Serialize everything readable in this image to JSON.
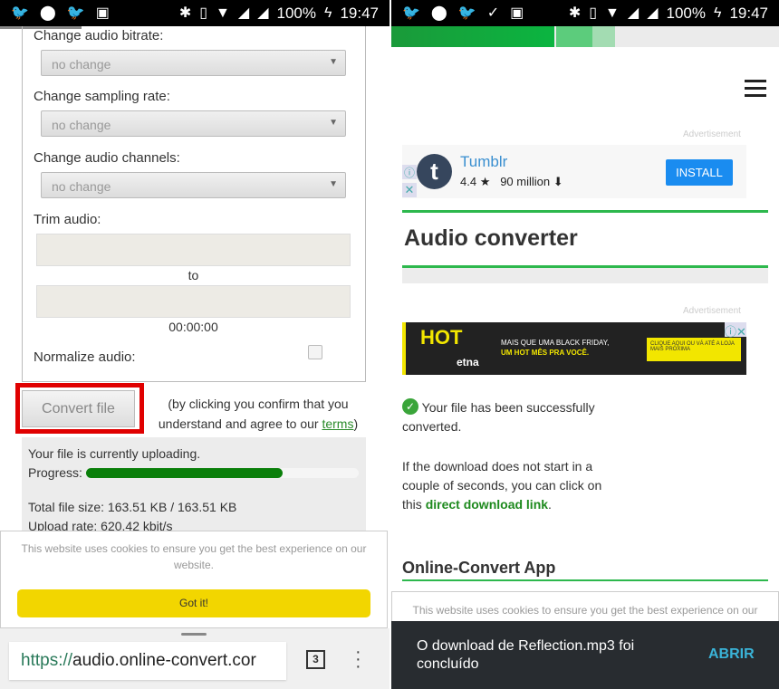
{
  "status_bar": {
    "left_icons": [
      "twitter-icon",
      "periscope-icon",
      "twitter-icon",
      "image-icon"
    ],
    "right_left_icons": [
      "twitter-icon",
      "periscope-icon",
      "twitter-icon",
      "download-done-icon",
      "image-icon"
    ],
    "system_icons": [
      "bluetooth-icon",
      "vibrate-icon",
      "wifi-icon",
      "signal-icon",
      "signal-icon"
    ],
    "battery": "100%",
    "time": "19:47"
  },
  "left": {
    "options": [
      {
        "label": "Change audio bitrate:",
        "value": "no change"
      },
      {
        "label": "Change sampling rate:",
        "value": "no change"
      },
      {
        "label": "Change audio channels:",
        "value": "no change"
      }
    ],
    "trim_label": "Trim audio:",
    "trim_to": "to",
    "trim_time": "00:00:00",
    "normalize_label": "Normalize audio:",
    "normalize_checked": false,
    "convert_button": "Convert file",
    "terms_text_1": "(by clicking you confirm that you",
    "terms_text_2": "understand and agree to our ",
    "terms_link": "terms",
    "terms_close": ")",
    "upload_status": "Your file is currently uploading.",
    "progress_label": "Progress:",
    "progress_percent": 72,
    "total_size": "Total file size: 163.51 KB / 163.51 KB",
    "upload_rate": "Upload rate: 620.42 kbit/s",
    "cookie_text": "This website uses cookies to ensure you get the best experience on our website.",
    "cookie_button": "Got it!",
    "url_scheme": "https://",
    "url_host": "audio.online-convert.cor",
    "tab_count": "3",
    "highlight_color": "#e00000"
  },
  "right": {
    "page_load_percent": 42,
    "ad_label": "Advertisement",
    "ad1": {
      "app": "Tumblr",
      "rating": "4.4",
      "downloads": "90 million",
      "button": "INSTALL"
    },
    "title": "Audio converter",
    "ad2_label": "Advertisement",
    "ad2": {
      "brand": "HOT",
      "sub": "etna",
      "line1": "MAIS QUE UMA BLACK FRIDAY,",
      "line2": "UM HOT MÊS PRA VOCÊ.",
      "cta": "CLIQUE AQUI OU VÁ ATÉ A LOJA MAIS PRÓXIMA"
    },
    "success_text": "Your file has been successfully converted.",
    "download_text": "If the download does not start in a couple of seconds, you can click on this ",
    "download_link": "direct download link",
    "download_end": ".",
    "app_heading": "Online-Convert App",
    "cookie_text": "This website uses cookies to ensure you get the best experience on our",
    "snackbar_text": "O download de Reflection.mp3 foi concluído",
    "snackbar_action": "ABRIR",
    "accent_green": "#2db84d",
    "link_green": "#1e8a1e"
  }
}
